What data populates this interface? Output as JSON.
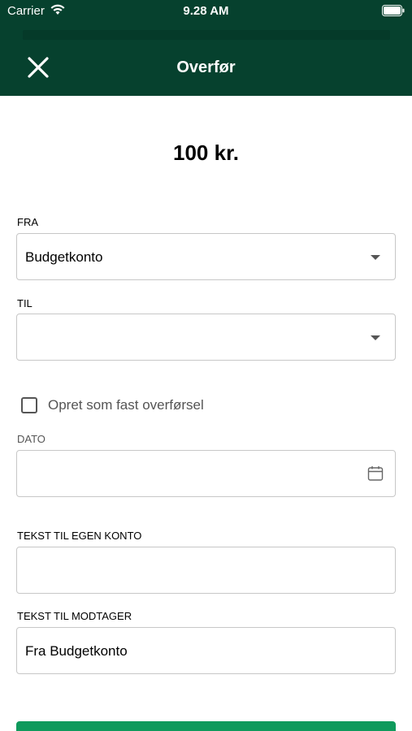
{
  "status_bar": {
    "carrier": "Carrier",
    "time": "9.28 AM"
  },
  "nav": {
    "title": "Overfør"
  },
  "amount": "100 kr.",
  "from": {
    "label": "FRA",
    "value": "Budgetkonto"
  },
  "to": {
    "label": "TIL",
    "value": ""
  },
  "standing_order": {
    "label": "Opret som fast overførsel",
    "checked": false
  },
  "date": {
    "label": "DATO",
    "value": ""
  },
  "own_text": {
    "label": "TEKST TIL EGEN KONTO",
    "value": ""
  },
  "recipient_text": {
    "label": "TEKST TIL MODTAGER",
    "value": "Fra Budgetkonto"
  },
  "colors": {
    "header": "#06412e",
    "button": "#0f9a5c",
    "border": "#c7c7c7"
  },
  "icons": [
    "wifi-icon",
    "battery-icon",
    "close-icon",
    "chevron-down-icon",
    "calendar-icon",
    "checkbox-icon"
  ]
}
